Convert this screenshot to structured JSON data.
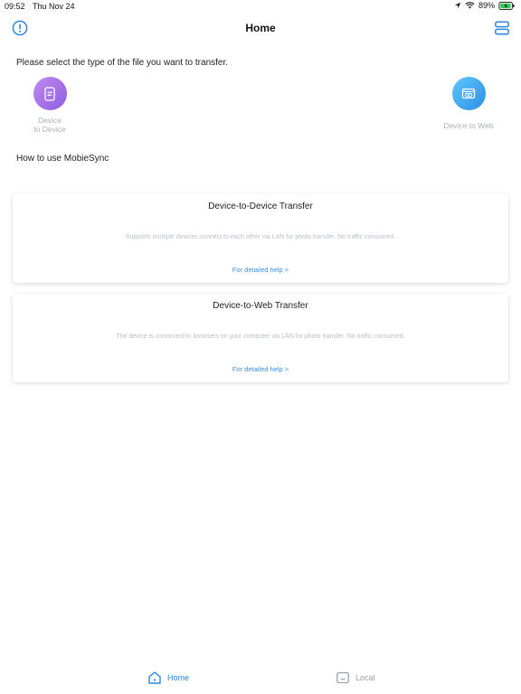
{
  "status_bar": {
    "time": "09:52",
    "date": "Thu Nov 24",
    "battery": "89%"
  },
  "nav": {
    "title": "Home",
    "left_icon": "info-icon",
    "right_icon": "menu-icon"
  },
  "main": {
    "prompt": "Please select the type of the file you want to transfer.",
    "options": [
      {
        "label_line1": "Device",
        "label_line2": "to Device",
        "icon": "device-transfer-icon"
      },
      {
        "label": "Device to Web",
        "icon": "web-transfer-icon"
      }
    ],
    "how_to_title": "How to use MobieSync",
    "cards": [
      {
        "title": "Device-to-Device Transfer",
        "description": "Supports multiple devices connect to each other via LAN for photo transfer. No traffic consumed.",
        "link": "For detailed help >"
      },
      {
        "title": "Device-to-Web Transfer",
        "description": "The device is connected to browsers on your computer via LAN for photo transfer. No traffic consumed.",
        "link": "For detailed help >"
      }
    ]
  },
  "tabs": [
    {
      "label": "Home",
      "icon": "home-icon",
      "active": true
    },
    {
      "label": "Local",
      "icon": "folder-icon",
      "active": false
    }
  ],
  "colors": {
    "accent": "#2f86e0",
    "d2d_gradient": [
      "#c18af0",
      "#8e5ee0"
    ],
    "d2w_gradient": [
      "#5ec6f8",
      "#2f8fe8"
    ]
  }
}
